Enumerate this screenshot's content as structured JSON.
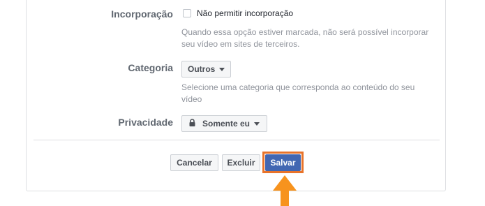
{
  "form": {
    "embed": {
      "label": "Incorporação",
      "checkbox_label": "Não permitir incorporação",
      "checked": false,
      "help_text": "Quando essa opção estiver marcada, não será possível incorporar seu vídeo em sites de terceiros."
    },
    "category": {
      "label": "Categoria",
      "selected": "Outros",
      "help_text": "Selecione uma categoria que corresponda ao conteúdo do seu vídeo"
    },
    "privacy": {
      "label": "Privacidade",
      "selected": "Somente eu",
      "icon": "lock-icon"
    }
  },
  "actions": {
    "cancel_label": "Cancelar",
    "delete_label": "Excluir",
    "save_label": "Salvar"
  },
  "annotation": {
    "highlight_color": "#e8732a",
    "arrow_icon": "up-arrow-icon"
  },
  "colors": {
    "primary": "#4267b2",
    "label": "#606770",
    "help": "#90949c",
    "border": "#dddfe2"
  }
}
